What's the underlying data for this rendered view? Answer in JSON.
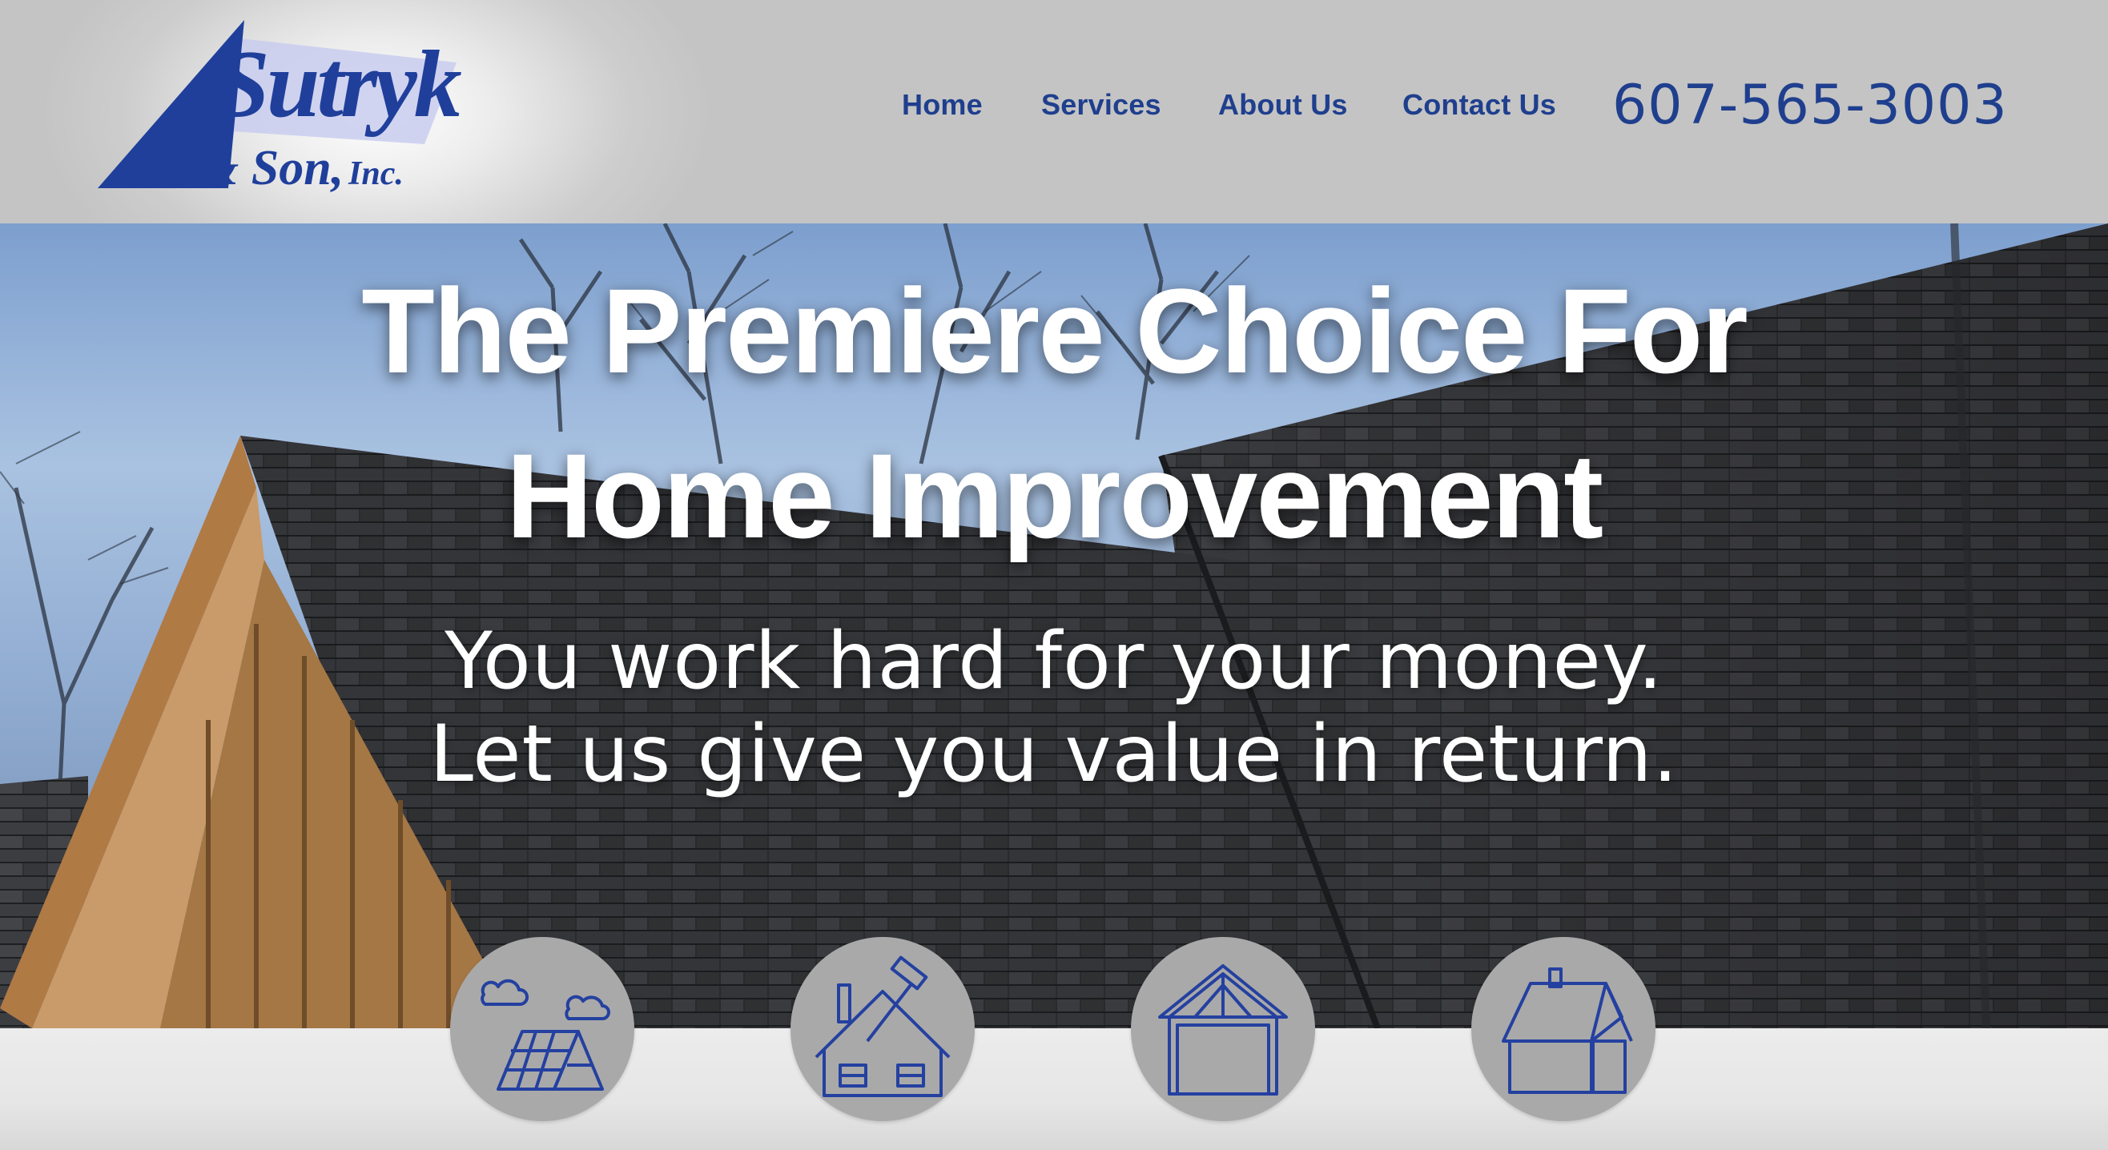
{
  "brand": {
    "logo_main": "Sutryk",
    "logo_sub": "& Son, Inc.",
    "primary_color": "#1f3f8e"
  },
  "nav": {
    "items": [
      {
        "label": "Home"
      },
      {
        "label": "Services"
      },
      {
        "label": "About Us"
      },
      {
        "label": "Contact Us"
      }
    ],
    "phone": "607-565-3003"
  },
  "hero": {
    "title_line1": "The Premiere Choice For",
    "title_line2": "Home Improvement",
    "subtitle_line1": "You work hard for your money.",
    "subtitle_line2": "Let us give you value in return."
  },
  "services": [
    {
      "icon": "solar-roof-icon"
    },
    {
      "icon": "house-repair-hammer-icon"
    },
    {
      "icon": "house-framing-icon"
    },
    {
      "icon": "house-chimney-icon"
    }
  ]
}
